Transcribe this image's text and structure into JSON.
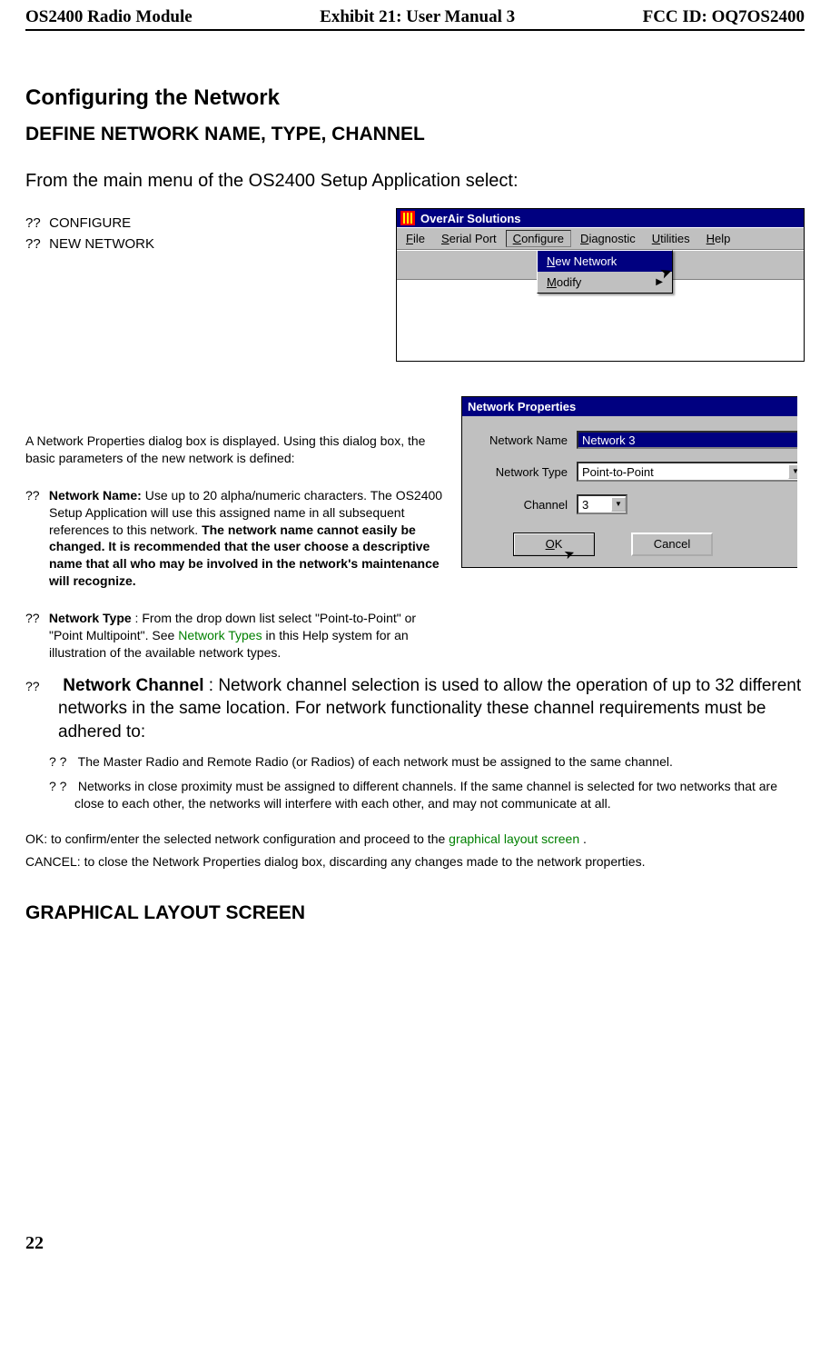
{
  "header": {
    "left": "OS2400 Radio Module",
    "center": "Exhibit 21: User Manual 3",
    "right": "FCC ID: OQ7OS2400"
  },
  "section_title": "Configuring the Network",
  "subhead_define": "DEFINE NETWORK NAME, TYPE, CHANNEL",
  "intro": "From the main menu of the OS2400 Setup Application select:",
  "steps": {
    "bullet": "??",
    "configure": "CONFIGURE",
    "new_network": "NEW NETWORK"
  },
  "win1": {
    "title": "OverAir Solutions",
    "menu": {
      "file": "File",
      "serial_port": "Serial Port",
      "configure": "Configure",
      "diagnostic": "Diagnostic",
      "utilities": "Utilities",
      "help": "Help"
    },
    "dropdown": {
      "new_network": "New Network",
      "modify": "Modify"
    }
  },
  "props_intro": "A Network Properties dialog box is displayed.  Using this dialog box, the basic parameters of the new network is defined:",
  "nn": {
    "bullet": "??",
    "label": "Network Name:",
    "text_a": " Use up to 20 alpha/numeric characters.  The OS2400 Setup Application will use this assigned name in all subsequent references to this network.  ",
    "text_bold": "The network name cannot easily be changed.  It is recommended that the user choose a descriptive name that all who may be involved in the network's maintenance will recognize."
  },
  "nt": {
    "bullet": "??",
    "label": "Network Type",
    "text_a": ": From the drop down list select \"Point-to-Point\" or \"Point Multipoint\".   See ",
    "link": "Network Types",
    "text_b": " in this Help system for an illustration of the available network types."
  },
  "nc": {
    "bullet": "??",
    "label": "Network Channel",
    "text": ": Network channel selection is used to allow the operation of up to 32 different networks in the same location.  For network functionality these channel requirements must be adhered to:"
  },
  "sub": {
    "mark": "? ?",
    "a": "The Master Radio and Remote Radio (or Radios) of each network must be assigned to the same channel.",
    "b": "Networks in close proximity must be assigned to different channels.  If the same channel is selected for two networks that are close to each other, the networks will interfere with each other, and may not communicate at all."
  },
  "okcancel": {
    "ok_a": "OK: to confirm/enter the selected network configuration and proceed to the ",
    "ok_link": "graphical layout screen",
    "ok_b": ".",
    "cancel": "CANCEL: to close the Network Properties dialog box, discarding any changes made to the network properties."
  },
  "gls_head": "GRAPHICAL LAYOUT SCREEN",
  "win2": {
    "title": "Network Properties",
    "labels": {
      "name": "Network Name",
      "type": "Network Type",
      "channel": "Channel"
    },
    "values": {
      "name": "Network 3",
      "type": "Point-to-Point",
      "channel": "3"
    },
    "buttons": {
      "ok": "OK",
      "cancel": "Cancel"
    }
  },
  "page_number": "22"
}
